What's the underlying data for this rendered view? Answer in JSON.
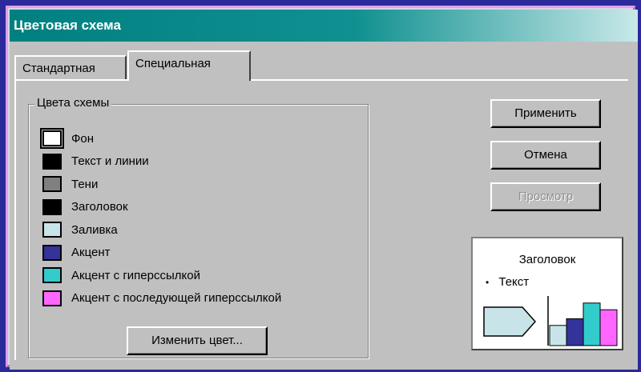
{
  "window": {
    "title": "Цветовая схема"
  },
  "tabs": [
    {
      "label": "Стандартная",
      "active": false
    },
    {
      "label": "Специальная",
      "active": true
    }
  ],
  "scheme_colors": {
    "group_label": "Цвета схемы",
    "items": [
      {
        "label": "Фон",
        "color": "#ffffff",
        "selected": true
      },
      {
        "label": "Текст и линии",
        "color": "#000000",
        "selected": false
      },
      {
        "label": "Тени",
        "color": "#808080",
        "selected": false
      },
      {
        "label": "Заголовок",
        "color": "#000000",
        "selected": false
      },
      {
        "label": "Заливка",
        "color": "#c8e4e8",
        "selected": false
      },
      {
        "label": "Акцент",
        "color": "#333399",
        "selected": false
      },
      {
        "label": "Акцент с гиперссылкой",
        "color": "#33cccc",
        "selected": false
      },
      {
        "label": "Акцент с последующей гиперссылкой",
        "color": "#ff66ff",
        "selected": false
      }
    ],
    "change_color_label": "Изменить цвет..."
  },
  "buttons": {
    "apply": "Применить",
    "cancel": "Отмена",
    "preview": "Просмотр"
  },
  "preview": {
    "title": "Заголовок",
    "bullet": "Текст",
    "bars": [
      {
        "value": 0.45,
        "color": "#c8e4e8"
      },
      {
        "value": 0.6,
        "color": "#333399"
      },
      {
        "value": 0.95,
        "color": "#33cccc"
      },
      {
        "value": 0.8,
        "color": "#ff66ff"
      }
    ],
    "arrow_color": "#c8e4e8"
  }
}
